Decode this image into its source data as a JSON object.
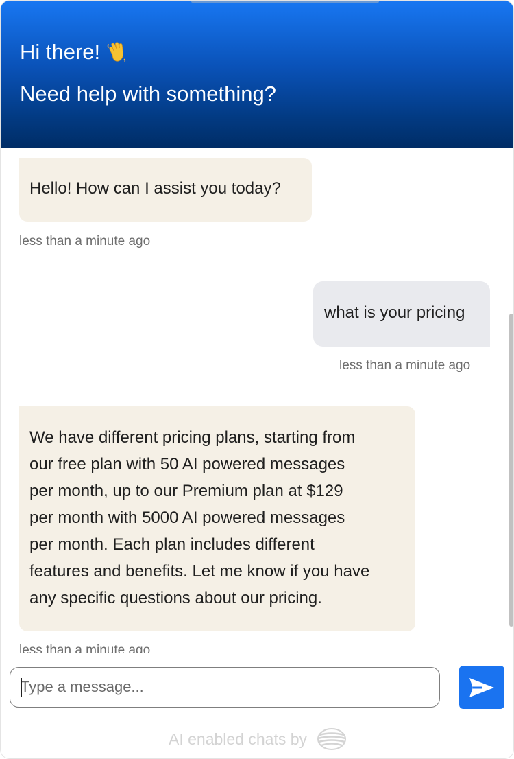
{
  "header": {
    "greeting": "Hi there!",
    "greeting_emoji": "waving-hand-icon",
    "subtitle": "Need help with something?",
    "gradient_top": "#1877f2",
    "gradient_bottom": "#002d66"
  },
  "messages": [
    {
      "role": "bot",
      "text": "Hello! How can I assist you today?",
      "time": "less than a minute ago"
    },
    {
      "role": "user",
      "text": "what is your pricing",
      "time": "less than a minute ago"
    },
    {
      "role": "bot",
      "lines": [
        "We have different pricing plans, starting from",
        "our free plan with 50 AI powered messages",
        "per month, up to our Premium plan at $129",
        "per month with 5000 AI powered messages",
        "per month. Each plan includes different",
        "features and benefits. Let me know if you have",
        "any specific questions about our pricing."
      ],
      "time": "less than a minute ago"
    }
  ],
  "composer": {
    "placeholder": "Type a message...",
    "value": "",
    "send_icon": "send-arrow-icon",
    "send_color": "#1a73f0"
  },
  "footer": {
    "text": "AI enabled chats by",
    "logo_icon": "brand-logo-icon"
  },
  "colors": {
    "bot_bubble": "#f5f0e6",
    "user_bubble": "#e9eaee"
  }
}
